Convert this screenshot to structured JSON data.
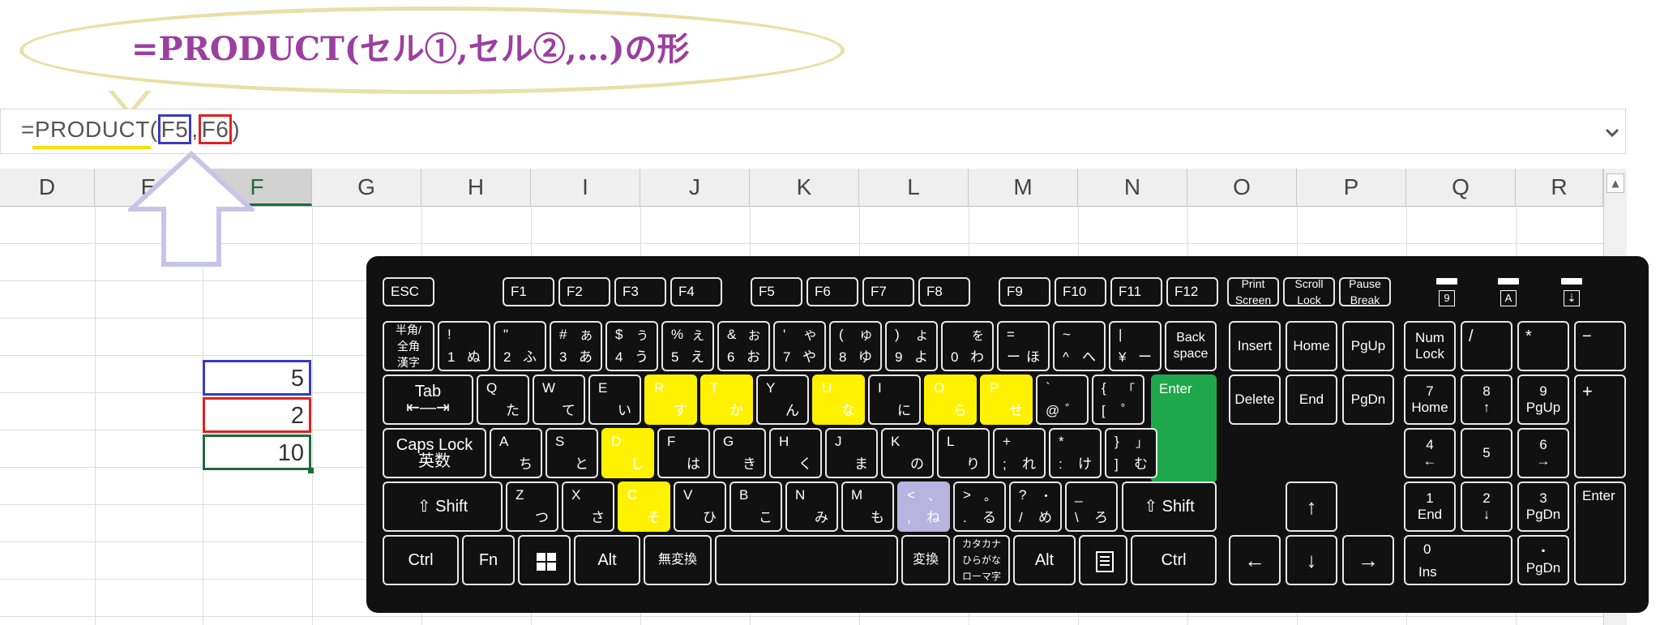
{
  "callout": {
    "text": "=PRODUCT(セル①,セル②,…)の形"
  },
  "formula_bar": {
    "prefix": "=PRODUCT(",
    "ref1": "F5",
    "sep": ",",
    "ref2": "F6",
    "suffix": ")",
    "expand_icon": "chevron-down-icon"
  },
  "columns": [
    "D",
    "E",
    "F",
    "G",
    "H",
    "I",
    "J",
    "K",
    "L",
    "M",
    "N",
    "O",
    "P",
    "Q",
    "R"
  ],
  "selected_column": "F",
  "cells": {
    "f5": "5",
    "f6": "2",
    "f7": "10"
  },
  "colors": {
    "accent_yellow": "#fff200",
    "enter_green": "#1fa84b",
    "comma_key": "#b9b3e0",
    "ref1_border": "#3a3ac0",
    "ref2_border": "#e02020",
    "active_cell": "#1e6b3a",
    "callout_text": "#9b3fa0"
  },
  "keyboard": {
    "fn_row": [
      "ESC",
      "F1",
      "F2",
      "F3",
      "F4",
      "F5",
      "F6",
      "F7",
      "F8",
      "F9",
      "F10",
      "F11",
      "F12"
    ],
    "sys_keys": [
      [
        "Print",
        "Screen"
      ],
      [
        "Scroll",
        "Lock"
      ],
      [
        "Pause",
        "Break"
      ]
    ],
    "leds": [
      "9",
      "A",
      "⇣"
    ],
    "hankaku": [
      "半角/",
      "全角",
      "漢字"
    ],
    "num_row": [
      {
        "tl": "!",
        "bl": "1",
        "br": "ぬ"
      },
      {
        "tl": "\"",
        "bl": "2",
        "br": "ふ"
      },
      {
        "tl": "#",
        "tr": "あ",
        "bl": "3",
        "br": "あ"
      },
      {
        "tl": "$",
        "tr": "う",
        "bl": "4",
        "br": "う"
      },
      {
        "tl": "%",
        "tr": "え",
        "bl": "5",
        "br": "え"
      },
      {
        "tl": "&",
        "tr": "お",
        "bl": "6",
        "br": "お"
      },
      {
        "tl": "'",
        "tr": "や",
        "bl": "7",
        "br": "や"
      },
      {
        "tl": "(",
        "tr": "ゆ",
        "bl": "8",
        "br": "ゆ"
      },
      {
        "tl": ")",
        "tr": "よ",
        "bl": "9",
        "br": "よ"
      },
      {
        "tr": "を",
        "bl": "0",
        "br": "わ"
      },
      {
        "tl": "=",
        "bl": "ー",
        "br": "ほ"
      },
      {
        "tl": "~",
        "bl": "^",
        "br": "へ"
      },
      {
        "tl": "|",
        "bl": "¥",
        "br": "ー"
      }
    ],
    "backspace": [
      "Back",
      "space"
    ],
    "tab": "Tab",
    "q_row": [
      {
        "tl": "Q",
        "br": "た"
      },
      {
        "tl": "W",
        "br": "て"
      },
      {
        "tl": "E",
        "br": "い"
      },
      {
        "tl": "R",
        "br": "す"
      },
      {
        "tl": "T",
        "br": "か"
      },
      {
        "tl": "Y",
        "br": "ん"
      },
      {
        "tl": "U",
        "br": "な"
      },
      {
        "tl": "I",
        "br": "に"
      },
      {
        "tl": "O",
        "br": "ら"
      },
      {
        "tl": "P",
        "br": "せ"
      },
      {
        "tl": "`",
        "bl": "@",
        "br": "゛"
      },
      {
        "tl": "{",
        "tr": "「",
        "bl": "[",
        "br": "゜"
      }
    ],
    "enter": "Enter",
    "caps": [
      "Caps Lock",
      "英数"
    ],
    "a_row": [
      {
        "tl": "A",
        "br": "ち"
      },
      {
        "tl": "S",
        "br": "と"
      },
      {
        "tl": "D",
        "br": "し"
      },
      {
        "tl": "F",
        "br": "は"
      },
      {
        "tl": "G",
        "br": "き"
      },
      {
        "tl": "H",
        "br": "く"
      },
      {
        "tl": "J",
        "br": "ま"
      },
      {
        "tl": "K",
        "br": "の"
      },
      {
        "tl": "L",
        "br": "り"
      },
      {
        "tl": "+",
        "bl": ";",
        "br": "れ"
      },
      {
        "tl": "*",
        "bl": ":",
        "br": "け"
      },
      {
        "tl": "}",
        "tr": "」",
        "bl": "]",
        "br": "む"
      }
    ],
    "shift": "⇧ Shift",
    "z_row": [
      {
        "tl": "Z",
        "br": "つ"
      },
      {
        "tl": "X",
        "br": "さ"
      },
      {
        "tl": "C",
        "br": "そ"
      },
      {
        "tl": "V",
        "br": "ひ"
      },
      {
        "tl": "B",
        "br": "こ"
      },
      {
        "tl": "N",
        "br": "み"
      },
      {
        "tl": "M",
        "br": "も"
      },
      {
        "tl": "<",
        "tr": "、",
        "bl": ",",
        "br": "ね"
      },
      {
        "tl": ">",
        "tr": "。",
        "bl": ".",
        "br": "る"
      },
      {
        "tl": "?",
        "tr": "・",
        "bl": "/",
        "br": "め"
      },
      {
        "tl": "_",
        "bl": "\\",
        "br": "ろ"
      }
    ],
    "bottom": {
      "ctrl": "Ctrl",
      "fn": "Fn",
      "win": "windows-icon",
      "alt": "Alt",
      "muhenkan": "無変換",
      "henkan": "変換",
      "kana": [
        "カタカナ",
        "ひらがな",
        "ローマ字"
      ],
      "menu": "menu-icon"
    },
    "nav": {
      "insert": "Insert",
      "home": "Home",
      "pgup": "PgUp",
      "delete": "Delete",
      "end": "End",
      "pgdn": "PgDn",
      "up": "↑",
      "left": "←",
      "down": "↓",
      "right": "→"
    },
    "numpad": {
      "numlock": [
        "Num",
        "Lock"
      ],
      "div": "/",
      "mul": "*",
      "minus": "−",
      "n7": [
        "7",
        "Home"
      ],
      "n8": [
        "8",
        "↑"
      ],
      "n9": [
        "9",
        "PgUp"
      ],
      "plus": "+",
      "n4": [
        "4",
        "←"
      ],
      "n5": "5",
      "n6": [
        "6",
        "→"
      ],
      "n1": [
        "1",
        "End"
      ],
      "n2": [
        "2",
        "↓"
      ],
      "n3": [
        "3",
        "PgDn"
      ],
      "enter": "Enter",
      "n0": [
        "0",
        "Ins"
      ],
      "dot": [
        "・",
        "PgDn"
      ]
    }
  }
}
